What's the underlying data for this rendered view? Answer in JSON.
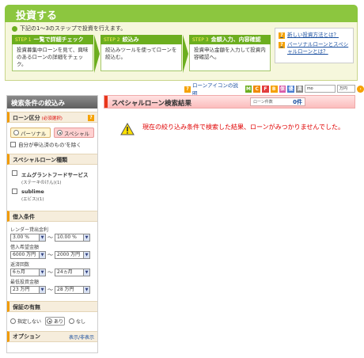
{
  "header": {
    "title": "投資する"
  },
  "steps_intro": "下記の1〜3のステップで投資を行えます。",
  "steps": [
    {
      "num": "STEP 1",
      "title": "一覧で詳細チェック",
      "body": "投資募集中ローンを見て、興味のあるローンの詳細をチェック。"
    },
    {
      "num": "STEP 2",
      "title": "絞込み",
      "body": "絞込みツールを使ってローンを絞込む。"
    },
    {
      "num": "STEP 3",
      "title": "金額入力、内容確認",
      "body": "投資申込金額を入力して投資内容確認へ。"
    }
  ],
  "help_links": [
    "新しい投資方法とは？",
    "バーソナルローンとスペシャルローンとは？"
  ],
  "legend": {
    "label": "ローンアイコンの説明",
    "tags": [
      {
        "text": "M",
        "color": "#6cae1f"
      },
      {
        "text": "C",
        "color": "#f08a00"
      },
      {
        "text": "F",
        "color": "#e23d3d"
      },
      {
        "text": "B",
        "color": "#f5a100"
      },
      {
        "text": "保",
        "color": "#d85aa8"
      },
      {
        "text": "優",
        "color": "#4a7bd0"
      },
      {
        "text": "満",
        "color": "#8a8a8a"
      }
    ],
    "search_value": "mo",
    "select_value": "万円"
  },
  "sidebar": {
    "title": "検索条件の絞込み",
    "loan_type": {
      "heading": "ローン区分",
      "required": "(必須選択)",
      "personal": "パーソナル",
      "special": "スペシャル",
      "own_only": "自分が申込済のもの'を除く"
    },
    "special_types": {
      "heading": "スペシャルローン種類",
      "items": [
        {
          "name": "エムグラントフードサービス",
          "sub": "(ステーキのけん)(1)"
        },
        {
          "name": "sublime",
          "sub": "(エビス)(1)"
        }
      ]
    },
    "loan_conditions": {
      "heading": "借入条件",
      "lender_rate_label": "レンダー貸出金利",
      "rate_min": "3.00 %",
      "rate_max": "10.00 %",
      "amount_label": "借入希望金額",
      "amount_min": "6000 万円",
      "amount_max": "2000 万円",
      "repay_label": "返済回数",
      "repay_min": "6ヵ月",
      "repay_max": "24ヵ月",
      "min_invest_label": "最低投資金額",
      "min_invest_min": "23 万円",
      "min_invest_max": "28 万円"
    },
    "guarantee": {
      "heading": "保証の有無",
      "options": [
        "指定しない",
        "あり",
        "なし"
      ]
    },
    "option": {
      "heading": "オプション",
      "toggle": "表示/非表示"
    }
  },
  "results": {
    "title": "スペシャルローン検索結果",
    "count_label": "ローン件数",
    "count_value": "0件",
    "message": "現在の絞り込み条件で検索した結果、ローンがみつかりませんでした。"
  }
}
